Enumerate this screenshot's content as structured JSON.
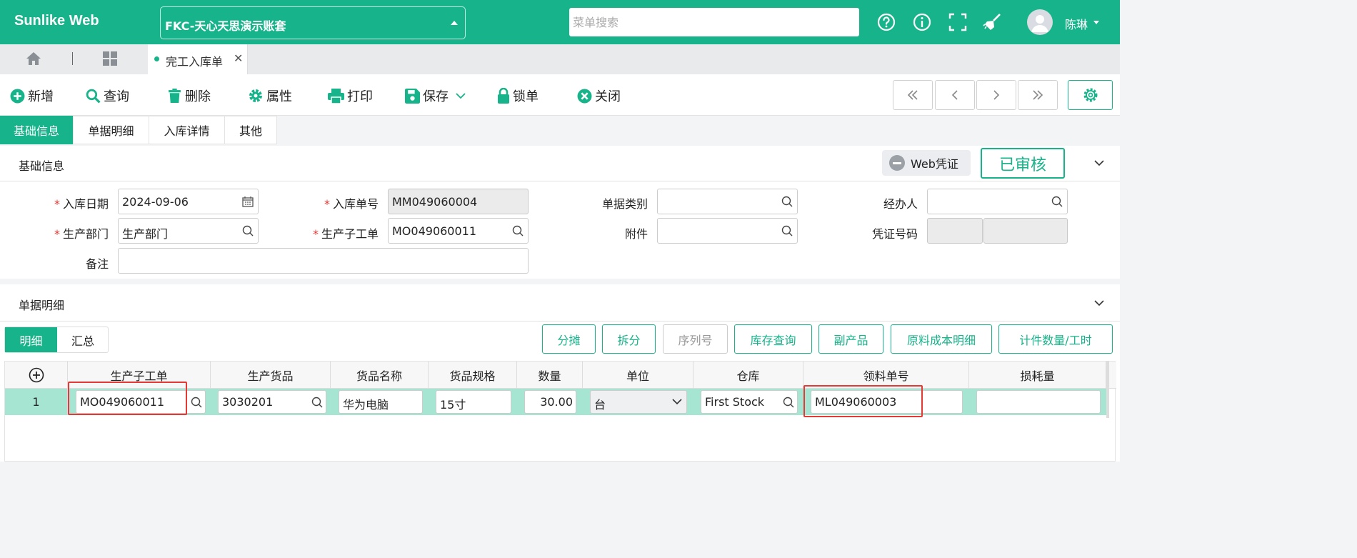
{
  "app": {
    "title": "Sunlike Web",
    "account": "FKC-天心天思演示账套",
    "search_placeholder": "菜单搜索",
    "user": "陈琳"
  },
  "tabs": {
    "active": "完工入库单"
  },
  "toolbar": {
    "new": "新增",
    "query": "查询",
    "delete": "删除",
    "properties": "属性",
    "print": "打印",
    "save": "保存",
    "lock": "锁单",
    "close": "关闭"
  },
  "section_tabs": [
    "基础信息",
    "单据明细",
    "入库详情",
    "其他"
  ],
  "basic": {
    "header": "基础信息",
    "web_voucher": "Web凭证",
    "status": "已审核",
    "labels": {
      "in_date": "入库日期",
      "in_no": "入库单号",
      "doc_type": "单据类别",
      "handler": "经办人",
      "dept": "生产部门",
      "work_order": "生产子工单",
      "attachment": "附件",
      "voucher_no": "凭证号码",
      "remark": "备注"
    },
    "values": {
      "in_date": "2024-09-06",
      "in_no": "MM049060004",
      "doc_type": "",
      "handler": "",
      "dept": "生产部门",
      "work_order": "MO049060011",
      "attachment": "",
      "voucher_no_a": "",
      "voucher_no_b": "",
      "remark": ""
    }
  },
  "detail": {
    "header": "单据明细",
    "view_detail": "明细",
    "view_summary": "汇总",
    "buttons": [
      "分摊",
      "拆分",
      "序列号",
      "库存查询",
      "副产品",
      "原料成本明细",
      "计件数量/工时"
    ],
    "columns": [
      "生产子工单",
      "生产货品",
      "货品名称",
      "货品规格",
      "数量",
      "单位",
      "仓库",
      "领料单号",
      "损耗量"
    ],
    "rows": [
      {
        "index": "1",
        "work_order": "MO049060011",
        "product": "3030201",
        "name": "华为电脑",
        "spec": "15寸",
        "qty": "30.00",
        "unit": "台",
        "warehouse": "First Stock",
        "picking_no": "ML049060003",
        "loss": ""
      }
    ]
  },
  "colors": {
    "primary": "#17b38a",
    "highlight": "#e53935",
    "row_selected": "#a5e5d2"
  }
}
